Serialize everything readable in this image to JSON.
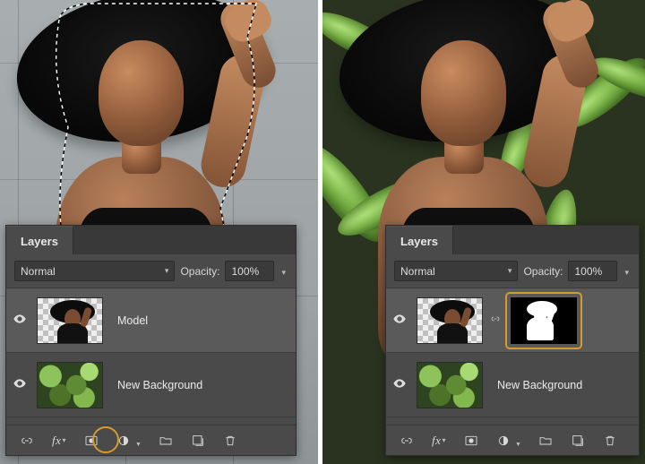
{
  "panel": {
    "title": "Layers",
    "blend_mode": "Normal",
    "opacity_label": "Opacity:",
    "opacity_value": "100%"
  },
  "left": {
    "layers": [
      {
        "name": "Model",
        "visible": true,
        "selected": true,
        "kind": "model-transparent"
      },
      {
        "name": "New Background",
        "visible": true,
        "selected": false,
        "kind": "foliage"
      }
    ]
  },
  "right": {
    "layers": [
      {
        "name": "",
        "visible": true,
        "selected": true,
        "kind": "model-transparent",
        "has_mask": true
      },
      {
        "name": "New Background",
        "visible": true,
        "selected": false,
        "kind": "foliage"
      }
    ]
  },
  "icons": {
    "link": "link-icon",
    "fx": "fx",
    "mask": "add-mask-icon",
    "adjust": "adjustment-icon",
    "group": "group-icon",
    "new": "new-layer-icon",
    "trash": "trash-icon",
    "eye": "visibility-icon"
  }
}
